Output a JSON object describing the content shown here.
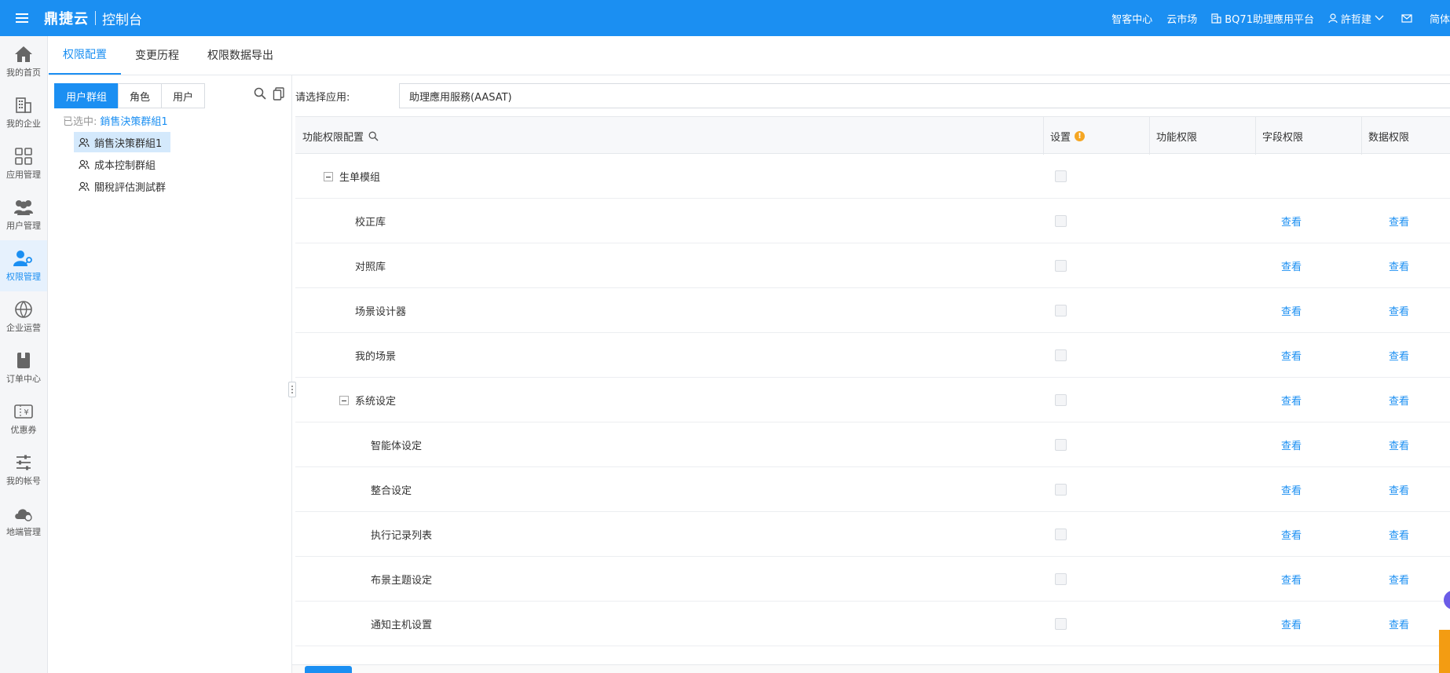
{
  "header": {
    "brand": "鼎捷云",
    "subtitle": "控制台",
    "links": {
      "help": "智客中心",
      "market": "云市场",
      "platform": "BQ71助理應用平台",
      "user": "許哲建",
      "lang": "简体"
    }
  },
  "sidebar": {
    "items": [
      {
        "label": "我的首页",
        "icon": "home-icon"
      },
      {
        "label": "我的企业",
        "icon": "building-icon"
      },
      {
        "label": "应用管理",
        "icon": "grid-icon"
      },
      {
        "label": "用户管理",
        "icon": "users-icon"
      },
      {
        "label": "权限管理",
        "icon": "user-key-icon"
      },
      {
        "label": "企业运营",
        "icon": "operations-icon"
      },
      {
        "label": "订单中心",
        "icon": "book-icon"
      },
      {
        "label": "优惠券",
        "icon": "coupon-icon"
      },
      {
        "label": "我的帐号",
        "icon": "sliders-icon"
      },
      {
        "label": "地端管理",
        "icon": "cloud-icon"
      }
    ]
  },
  "tabs": [
    "权限配置",
    "变更历程",
    "权限数据导出"
  ],
  "left": {
    "segments": [
      "用户群组",
      "角色",
      "用户"
    ],
    "selected_label": "已选中:",
    "selected_value": "銷售決策群組1",
    "groups": [
      "銷售決策群組1",
      "成本控制群組",
      "關稅評估測試群"
    ]
  },
  "app": {
    "label": "请选择应用:",
    "value": "助理應用服務(AASAT)"
  },
  "grid": {
    "headers": {
      "name": "功能权限配置",
      "setting": "设置",
      "func": "功能权限",
      "field": "字段权限",
      "data": "数据权限"
    },
    "rows": [
      {
        "name": "生单模组",
        "level": 0,
        "collapsible": true,
        "field": "",
        "data": ""
      },
      {
        "name": "校正库",
        "level": 1,
        "collapsible": false,
        "field": "查看",
        "data": "查看"
      },
      {
        "name": "对照库",
        "level": 1,
        "collapsible": false,
        "field": "查看",
        "data": "查看"
      },
      {
        "name": "场景设计器",
        "level": 1,
        "collapsible": false,
        "field": "查看",
        "data": "查看"
      },
      {
        "name": "我的场景",
        "level": 1,
        "collapsible": false,
        "field": "查看",
        "data": "查看"
      },
      {
        "name": "系统设定",
        "level": 1,
        "collapsible": true,
        "field": "查看",
        "data": "查看"
      },
      {
        "name": "智能体设定",
        "level": 2,
        "collapsible": false,
        "field": "查看",
        "data": "查看"
      },
      {
        "name": "整合设定",
        "level": 2,
        "collapsible": false,
        "field": "查看",
        "data": "查看"
      },
      {
        "name": "执行记录列表",
        "level": 2,
        "collapsible": false,
        "field": "查看",
        "data": "查看"
      },
      {
        "name": "布景主题设定",
        "level": 2,
        "collapsible": false,
        "field": "查看",
        "data": "查看"
      },
      {
        "name": "通知主机设置",
        "level": 2,
        "collapsible": false,
        "field": "查看",
        "data": "查看"
      }
    ]
  }
}
